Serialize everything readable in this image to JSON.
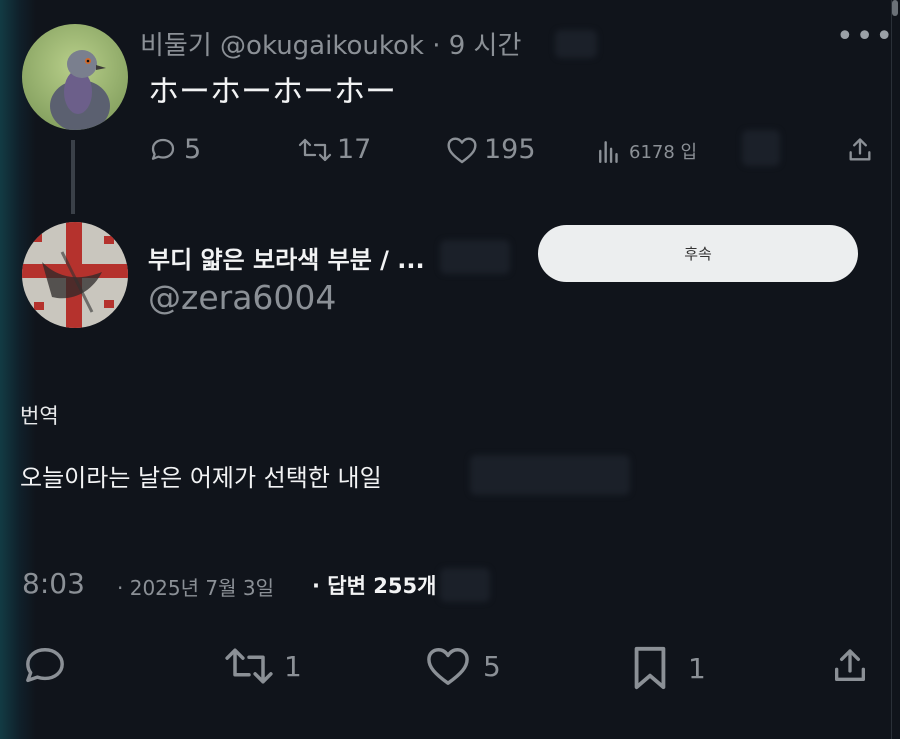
{
  "parent_tweet": {
    "display_name": "비둘기",
    "handle": "@okugaikoukok",
    "separator": "·",
    "time_ago": "9 시간",
    "text": "ホーホーホーホー",
    "more_label": "•••",
    "stats": {
      "replies": "5",
      "retweets": "17",
      "likes": "195",
      "views": "6178 입"
    }
  },
  "reply_author": {
    "name": "부디 얇은 보라색 부분 / ...",
    "handle": "@zera6004",
    "follow_label": "후속"
  },
  "translation": {
    "label": "번역",
    "text": "오늘이라는 날은 어제가 선택한 내일"
  },
  "meta": {
    "time": "8:03",
    "date": "· 2025년 7월 3일",
    "replies": "· 답변 255개"
  },
  "bottom_actions": {
    "retweets": "1",
    "likes": "5",
    "bookmarks": "1"
  },
  "colors": {
    "background": "#10141b",
    "muted_text": "#8b9096",
    "primary_text": "#f2f3f4",
    "follow_button_bg": "#eceeef"
  },
  "icons": [
    "pigeon-avatar",
    "reply-icon",
    "retweet-icon",
    "like-icon",
    "views-icon",
    "share-icon",
    "bookmark-icon",
    "more-icon"
  ]
}
